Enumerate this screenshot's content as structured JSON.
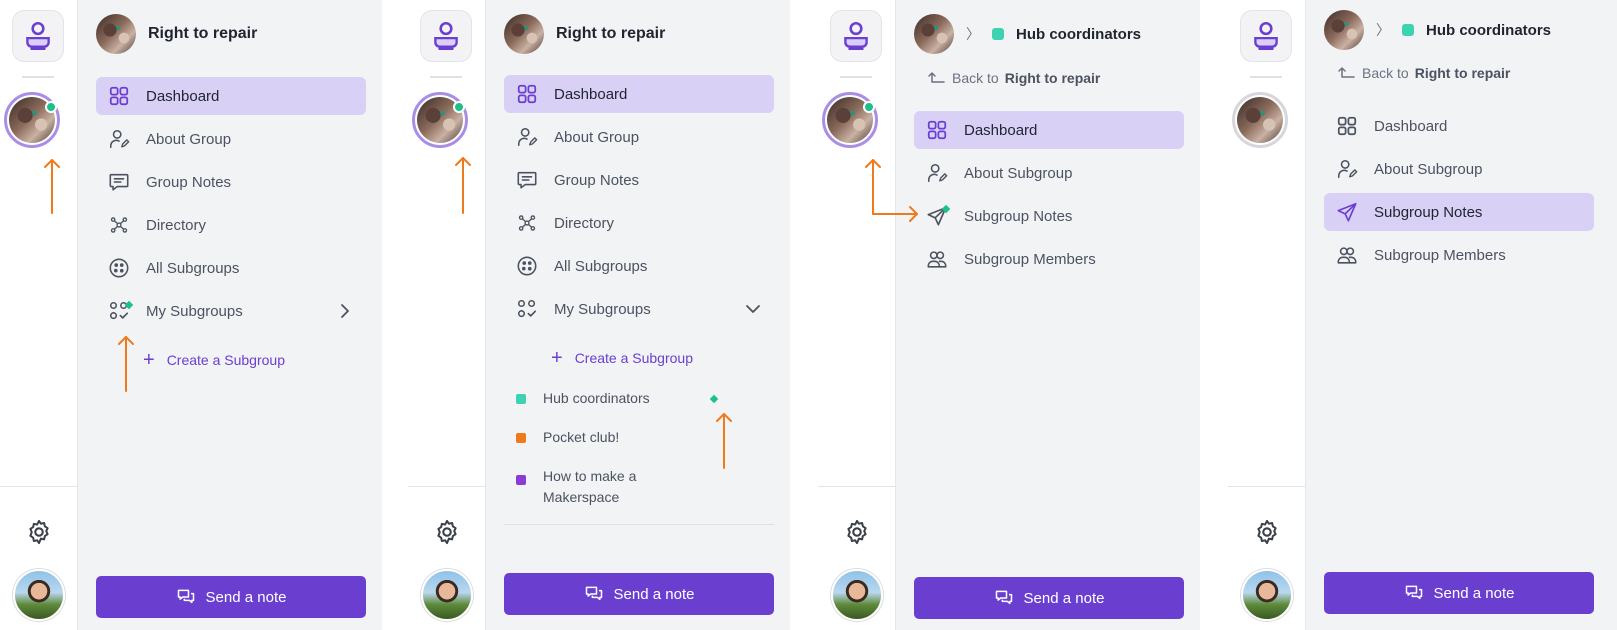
{
  "group": {
    "name": "Right to repair"
  },
  "subgroup": {
    "name": "Hub coordinators",
    "color": "#3ed3b0"
  },
  "breadcrumb": {
    "chevron": "〉",
    "back_prefix": "Back to",
    "back_target": "Right to repair"
  },
  "group_nav": {
    "dashboard": "Dashboard",
    "about": "About Group",
    "notes": "Group Notes",
    "directory": "Directory",
    "all_subgroups": "All Subgroups",
    "my_subgroups": "My Subgroups",
    "create_subgroup": "Create a Subgroup"
  },
  "subgroups_list": [
    {
      "name": "Hub coordinators",
      "color": "#3ed3b0"
    },
    {
      "name": "Pocket club!",
      "color": "#f07a1a"
    },
    {
      "name": "How to make a Makerspace",
      "color": "#8a3ad6"
    }
  ],
  "subgroup_nav": {
    "dashboard": "Dashboard",
    "about": "About Subgroup",
    "notes": "Subgroup Notes",
    "members": "Subgroup Members"
  },
  "send_note_label": "Send a note",
  "colors": {
    "accent": "#6a3fd0",
    "active_bg": "#d9d0f5",
    "online": "#1cc08a",
    "arrow": "#f07a1a"
  },
  "icons": [
    "app-logo-icon",
    "settings-icon",
    "dashboard-icon",
    "about-group-icon",
    "group-notes-icon",
    "directory-icon",
    "all-subgroups-icon",
    "my-subgroups-icon",
    "plus-icon",
    "chevron-right-icon",
    "chevron-down-icon",
    "back-arrow-icon",
    "paper-plane-icon",
    "members-icon",
    "chat-icon"
  ]
}
